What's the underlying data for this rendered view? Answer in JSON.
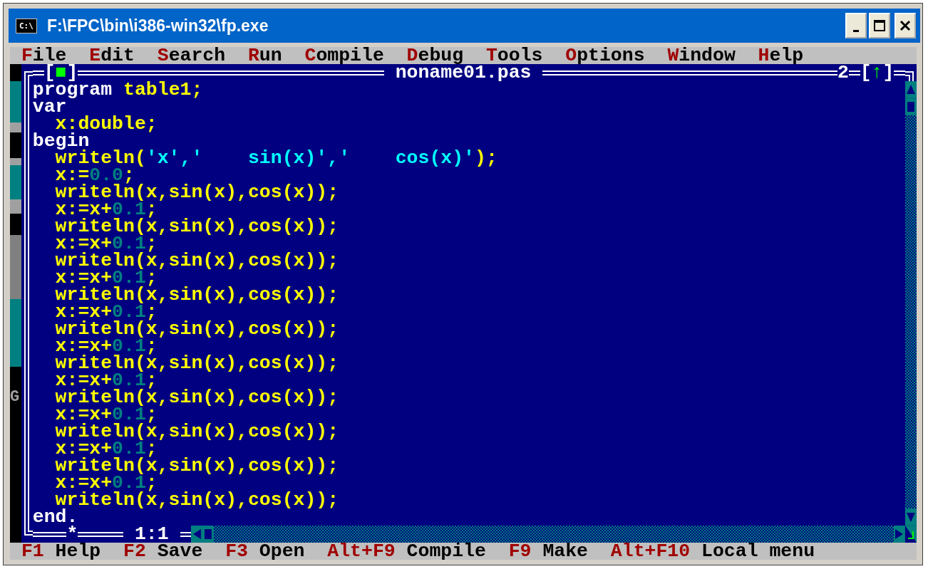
{
  "window": {
    "icon_text": "C:\\",
    "title": "F:\\FPC\\bin\\i386-win32\\fp.exe"
  },
  "menu": [
    {
      "hotkey": "F",
      "rest": "ile"
    },
    {
      "hotkey": "E",
      "rest": "dit"
    },
    {
      "hotkey": "S",
      "rest": "earch"
    },
    {
      "hotkey": "R",
      "rest": "un"
    },
    {
      "hotkey": "C",
      "rest": "ompile"
    },
    {
      "hotkey": "D",
      "rest": "ebug"
    },
    {
      "hotkey": "T",
      "rest": "ools"
    },
    {
      "hotkey": "O",
      "rest": "ptions"
    },
    {
      "hotkey": "W",
      "rest": "indow"
    },
    {
      "hotkey": "H",
      "rest": "elp"
    }
  ],
  "desktop_char": "G",
  "editor": {
    "close_box": {
      "open": "[",
      "mark": "■",
      "close": "]"
    },
    "title": "noname01.pas",
    "window_number": "2",
    "zoom_box": {
      "open": "[",
      "mark": "↑",
      "close": "]"
    },
    "lines": [
      [
        {
          "kind": "keyword",
          "text": "program "
        },
        {
          "kind": "ident",
          "text": "table1;"
        }
      ],
      [
        {
          "kind": "keyword",
          "text": "var"
        }
      ],
      [
        {
          "kind": "ident",
          "text": "  x:double;"
        }
      ],
      [
        {
          "kind": "keyword",
          "text": "begin"
        }
      ],
      [
        {
          "kind": "ident",
          "text": "  writeln("
        },
        {
          "kind": "string",
          "text": "'x','    sin(x)','    cos(x)'"
        },
        {
          "kind": "ident",
          "text": ");"
        }
      ],
      [
        {
          "kind": "ident",
          "text": "  x:="
        },
        {
          "kind": "number",
          "text": "0.0"
        },
        {
          "kind": "ident",
          "text": ";"
        }
      ],
      [
        {
          "kind": "ident",
          "text": "  writeln(x,sin(x),cos(x));"
        }
      ],
      [
        {
          "kind": "ident",
          "text": "  x:=x+"
        },
        {
          "kind": "number",
          "text": "0.1"
        },
        {
          "kind": "ident",
          "text": ";"
        }
      ],
      [
        {
          "kind": "ident",
          "text": "  writeln(x,sin(x),cos(x));"
        }
      ],
      [
        {
          "kind": "ident",
          "text": "  x:=x+"
        },
        {
          "kind": "number",
          "text": "0.1"
        },
        {
          "kind": "ident",
          "text": ";"
        }
      ],
      [
        {
          "kind": "ident",
          "text": "  writeln(x,sin(x),cos(x));"
        }
      ],
      [
        {
          "kind": "ident",
          "text": "  x:=x+"
        },
        {
          "kind": "number",
          "text": "0.1"
        },
        {
          "kind": "ident",
          "text": ";"
        }
      ],
      [
        {
          "kind": "ident",
          "text": "  writeln(x,sin(x),cos(x));"
        }
      ],
      [
        {
          "kind": "ident",
          "text": "  x:=x+"
        },
        {
          "kind": "number",
          "text": "0.1"
        },
        {
          "kind": "ident",
          "text": ";"
        }
      ],
      [
        {
          "kind": "ident",
          "text": "  writeln(x,sin(x),cos(x));"
        }
      ],
      [
        {
          "kind": "ident",
          "text": "  x:=x+"
        },
        {
          "kind": "number",
          "text": "0.1"
        },
        {
          "kind": "ident",
          "text": ";"
        }
      ],
      [
        {
          "kind": "ident",
          "text": "  writeln(x,sin(x),cos(x));"
        }
      ],
      [
        {
          "kind": "ident",
          "text": "  x:=x+"
        },
        {
          "kind": "number",
          "text": "0.1"
        },
        {
          "kind": "ident",
          "text": ";"
        }
      ],
      [
        {
          "kind": "ident",
          "text": "  writeln(x,sin(x),cos(x));"
        }
      ],
      [
        {
          "kind": "ident",
          "text": "  x:=x+"
        },
        {
          "kind": "number",
          "text": "0.1"
        },
        {
          "kind": "ident",
          "text": ";"
        }
      ],
      [
        {
          "kind": "ident",
          "text": "  writeln(x,sin(x),cos(x));"
        }
      ],
      [
        {
          "kind": "ident",
          "text": "  x:=x+"
        },
        {
          "kind": "number",
          "text": "0.1"
        },
        {
          "kind": "ident",
          "text": ";"
        }
      ],
      [
        {
          "kind": "ident",
          "text": "  writeln(x,sin(x),cos(x));"
        }
      ],
      [
        {
          "kind": "ident",
          "text": "  x:=x+"
        },
        {
          "kind": "number",
          "text": "0.1"
        },
        {
          "kind": "ident",
          "text": ";"
        }
      ],
      [
        {
          "kind": "ident",
          "text": "  writeln(x,sin(x),cos(x));"
        }
      ],
      [
        {
          "kind": "keyword",
          "text": "end."
        }
      ]
    ],
    "modified_marker": "*",
    "cursor_position": "1:1"
  },
  "status_bar": [
    {
      "key": "F1",
      "label": "Help"
    },
    {
      "key": "F2",
      "label": "Save"
    },
    {
      "key": "F3",
      "label": "Open"
    },
    {
      "key": "Alt+F9",
      "label": "Compile"
    },
    {
      "key": "F9",
      "label": "Make"
    },
    {
      "key": "Alt+F10",
      "label": "Local menu"
    }
  ]
}
